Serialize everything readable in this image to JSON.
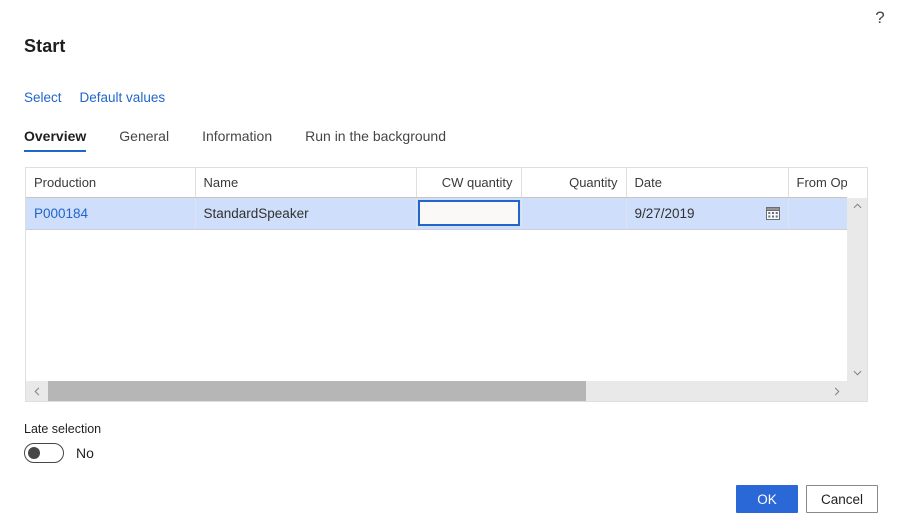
{
  "header": {
    "help_icon": "question-mark-icon",
    "title": "Start"
  },
  "command_bar": {
    "links": [
      {
        "label": "Select"
      },
      {
        "label": "Default values"
      }
    ]
  },
  "tabs": [
    {
      "label": "Overview",
      "active": true
    },
    {
      "label": "General",
      "active": false
    },
    {
      "label": "Information",
      "active": false
    },
    {
      "label": "Run in the background",
      "active": false
    }
  ],
  "grid": {
    "columns": [
      {
        "header": "Production",
        "align": "left"
      },
      {
        "header": "Name",
        "align": "left"
      },
      {
        "header": "CW quantity",
        "align": "right"
      },
      {
        "header": "Quantity",
        "align": "right"
      },
      {
        "header": "Date",
        "align": "left"
      },
      {
        "header": "From Oper. N",
        "align": "left"
      }
    ],
    "rows": [
      {
        "production": "P000184",
        "name": "StandardSpeaker",
        "cw_quantity": "",
        "cw_quantity_placeholder": "",
        "quantity": "",
        "date": "9/27/2019",
        "date_icon": "calendar-icon",
        "from_oper_n": ""
      }
    ],
    "vertical_scrollbar": {
      "up_arrow": "chevron-up-icon",
      "down_arrow": "chevron-down-icon"
    },
    "horizontal_scrollbar": {
      "left_arrow": "chevron-left-icon",
      "right_arrow": "chevron-right-icon"
    }
  },
  "late_selection": {
    "label": "Late selection",
    "value": "No",
    "checked": false
  },
  "footer": {
    "ok_label": "OK",
    "cancel_label": "Cancel"
  },
  "colors": {
    "accent": "#2266cc",
    "primary_button": "#2a68d8",
    "selected_row": "#cfdefa",
    "focus_border": "#2266cc"
  }
}
